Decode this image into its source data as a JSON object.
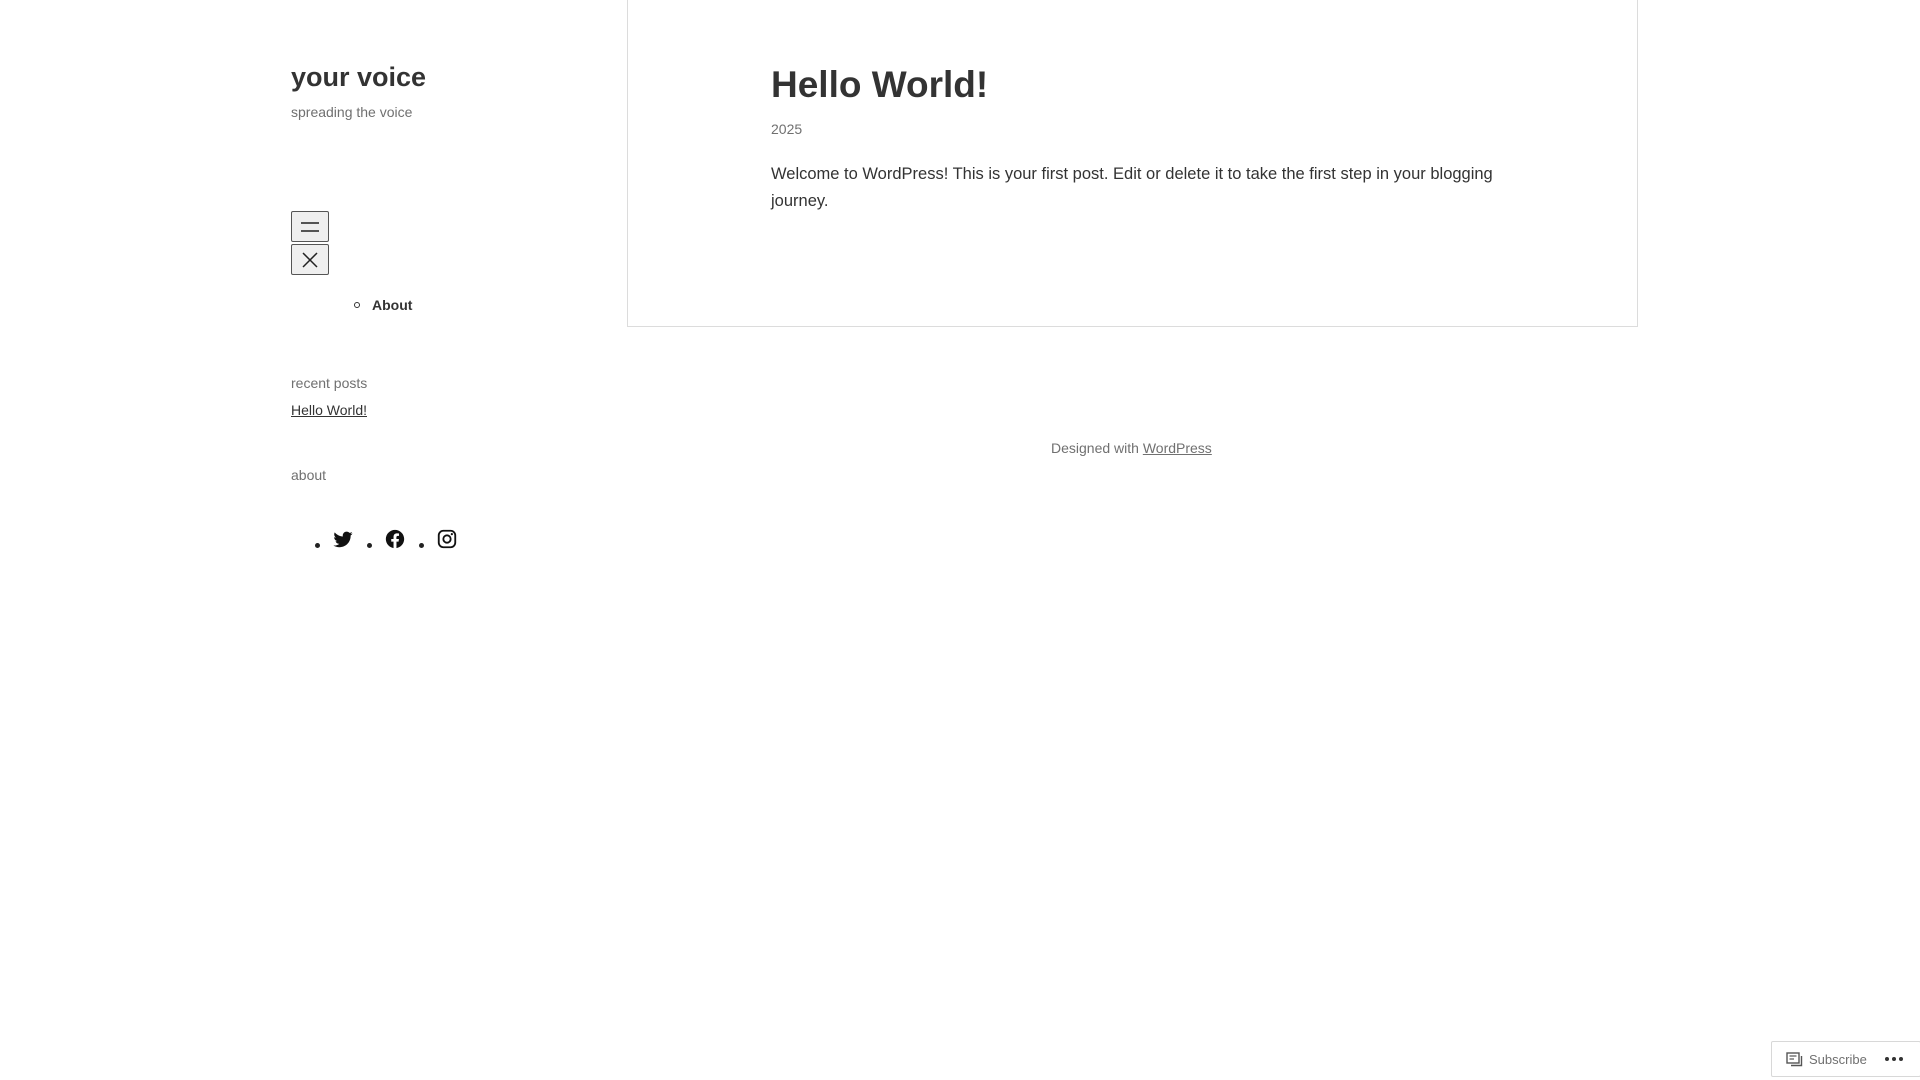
{
  "site": {
    "title": "your voice",
    "tagline": "spreading the voice"
  },
  "nav": {
    "open_icon": "hamburger-menu-icon",
    "close_icon": "close-icon",
    "items": [
      {
        "label": "About"
      }
    ]
  },
  "widgets": {
    "recent_posts": {
      "title": "recent posts",
      "items": [
        {
          "label": "Hello World!"
        }
      ]
    },
    "about": {
      "title": "about",
      "social_icons": [
        "twitter-icon",
        "facebook-icon",
        "instagram-icon"
      ]
    }
  },
  "post": {
    "title": "Hello World!",
    "date": "2025",
    "body": "Welcome to WordPress! This is your first post. Edit or delete it to take the first step in your blogging journey."
  },
  "footer": {
    "prefix": "Designed with",
    "link": "WordPress"
  },
  "subscribe": {
    "label": "Subscribe",
    "icon": "reader-icon",
    "more_icon": "more-horizontal-icon"
  },
  "colors": {
    "text": "#333333",
    "muted": "#707070",
    "border": "#dcdcdc",
    "background": "#ffffff"
  }
}
